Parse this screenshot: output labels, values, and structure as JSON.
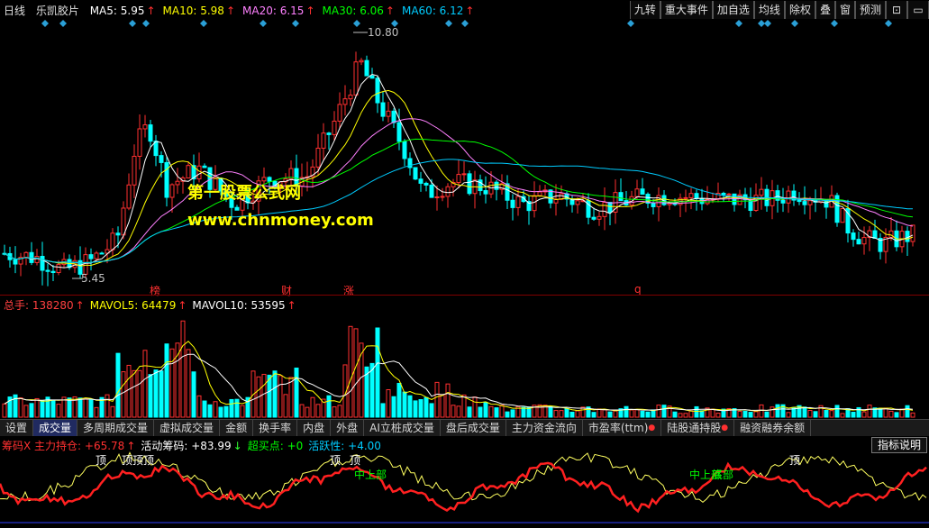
{
  "header": {
    "period": "日线",
    "stock_name": "乐凯胶片",
    "ma": [
      {
        "label": "MA5: 5.95",
        "color": "#ffffff",
        "dir": "up"
      },
      {
        "label": "MA10: 5.98",
        "color": "#ffff00",
        "dir": "up"
      },
      {
        "label": "MA20: 6.15",
        "color": "#ff80ff",
        "dir": "up"
      },
      {
        "label": "MA30: 6.06",
        "color": "#00ff00",
        "dir": "up"
      },
      {
        "label": "MA60: 6.12",
        "color": "#00ccff",
        "dir": "up"
      }
    ]
  },
  "toolbar": [
    "九转",
    "重大事件",
    "加自选",
    "均线",
    "除权",
    "叠",
    "窗",
    "预测"
  ],
  "toolbar_icons": [
    "lock-icon",
    "window-icon"
  ],
  "price_notes": {
    "high": "10.80",
    "low": "5.45"
  },
  "event_markers": [
    "榜",
    "财",
    "涨",
    "q"
  ],
  "watermark": {
    "line1": "第一股票公式网",
    "line2": "www.chnmoney.com"
  },
  "volume_legend": [
    {
      "label": "总手: 138280",
      "color": "#ff4040",
      "dir": "up"
    },
    {
      "label": "MAVOL5: 64479",
      "color": "#ffff00",
      "dir": "up"
    },
    {
      "label": "MAVOL10: 53595",
      "color": "#ffffff",
      "dir": "up"
    }
  ],
  "tabs": [
    {
      "label": "设置",
      "active": false,
      "dot": false
    },
    {
      "label": "成交量",
      "active": true,
      "dot": false
    },
    {
      "label": "多周期成交量",
      "active": false,
      "dot": false
    },
    {
      "label": "虚拟成交量",
      "active": false,
      "dot": false
    },
    {
      "label": "金额",
      "active": false,
      "dot": false
    },
    {
      "label": "换手率",
      "active": false,
      "dot": false
    },
    {
      "label": "内盘",
      "active": false,
      "dot": false
    },
    {
      "label": "外盘",
      "active": false,
      "dot": false
    },
    {
      "label": "AI立桩成交量",
      "active": false,
      "dot": false
    },
    {
      "label": "盘后成交量",
      "active": false,
      "dot": false
    },
    {
      "label": "主力资金流向",
      "active": false,
      "dot": false
    },
    {
      "label": "市盈率(ttm)",
      "active": false,
      "dot": true
    },
    {
      "label": "陆股通持股",
      "active": false,
      "dot": true
    },
    {
      "label": "融资融券余额",
      "active": false,
      "dot": false
    }
  ],
  "indicator_legend": [
    {
      "label": "筹码X 主力持仓: +65.78",
      "color": "#ff3030",
      "dir": "up"
    },
    {
      "label": "活动筹码: +83.99",
      "color": "#ffffff",
      "dir": "down"
    },
    {
      "label": "超买点: +0",
      "color": "#00ff00",
      "dir": ""
    },
    {
      "label": "活跃性: +4.00",
      "color": "#00ccff",
      "dir": ""
    }
  ],
  "indicator_button": "指标说明",
  "indicator_labels": [
    {
      "text": "顶",
      "color": "#ffffff"
    },
    {
      "text": "顶顶顶",
      "color": "#ffffff"
    },
    {
      "text": "顶",
      "color": "#ffffff"
    },
    {
      "text": "顶",
      "color": "#ffffff"
    },
    {
      "text": "中上部",
      "color": "#00ff00"
    },
    {
      "text": "中上部",
      "color": "#00ff00"
    },
    {
      "text": "底部",
      "color": "#00ff00"
    },
    {
      "text": "顶",
      "color": "#ffffff"
    }
  ],
  "colors": {
    "up": "#ff3030",
    "down": "#00ffff",
    "ma5": "#ffffff",
    "ma10": "#ffff00",
    "ma20": "#ff80ff",
    "ma30": "#00ff00",
    "ma60": "#00ccff"
  }
}
